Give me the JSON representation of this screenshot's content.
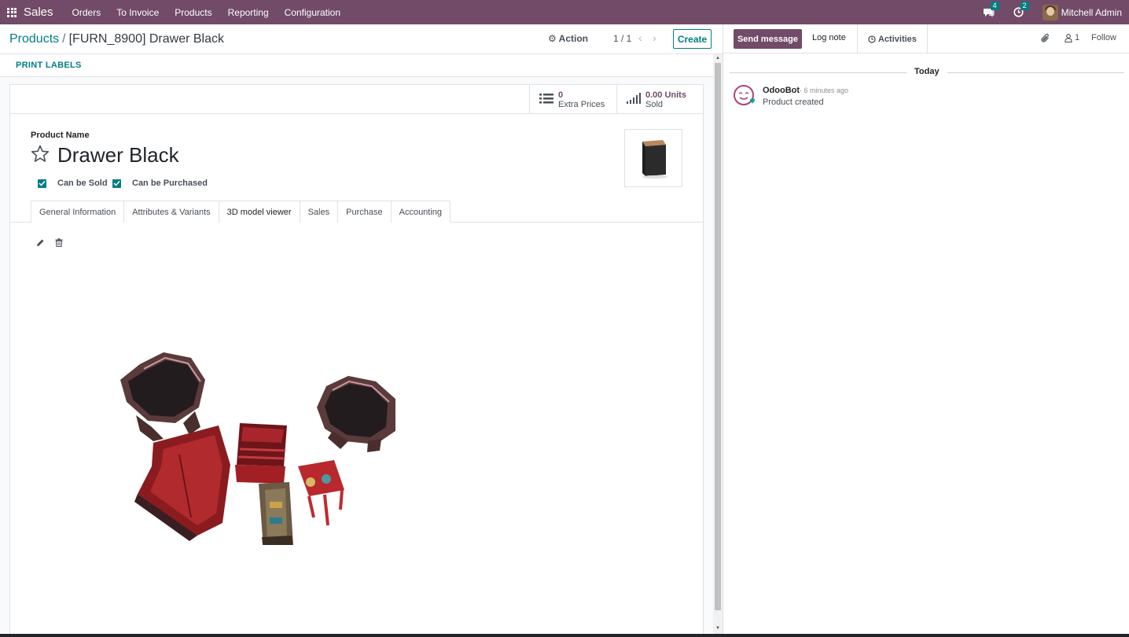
{
  "navbar": {
    "app_name": "Sales",
    "menu": [
      "Orders",
      "To Invoice",
      "Products",
      "Reporting",
      "Configuration"
    ],
    "messages_count": "4",
    "activities_count": "2",
    "user_name": "Mitchell Admin",
    "bg_color": "#714b67"
  },
  "control_panel": {
    "breadcrumb_parent": "Products",
    "breadcrumb_sep": "/",
    "breadcrumb_current": "[FURN_8900] Drawer Black",
    "action_label": "Action",
    "pager": "1 / 1",
    "create_label": "Create"
  },
  "statusbar": {
    "print_labels": "PRINT LABELS"
  },
  "smart_buttons": {
    "extra_prices_value": "0",
    "extra_prices_label": "Extra Prices",
    "sold_value": "0.00 Units",
    "sold_label": "Sold"
  },
  "form": {
    "product_name_label": "Product Name",
    "product_name": "Drawer Black",
    "can_be_sold": "Can be Sold",
    "can_be_purchased": "Can be Purchased",
    "tabs": [
      "General Information",
      "Attributes & Variants",
      "3D model viewer",
      "Sales",
      "Purchase",
      "Accounting"
    ],
    "active_tab": "3D model viewer"
  },
  "chatter": {
    "send_message": "Send message",
    "log_note": "Log note",
    "activities": "Activities",
    "followers_count": "1",
    "follow": "Follow",
    "today": "Today",
    "message": {
      "author": "OdooBot",
      "time": "- 6 minutes ago",
      "body": "Product created"
    }
  },
  "colors": {
    "brand": "#714b67",
    "accent": "#017e84"
  }
}
